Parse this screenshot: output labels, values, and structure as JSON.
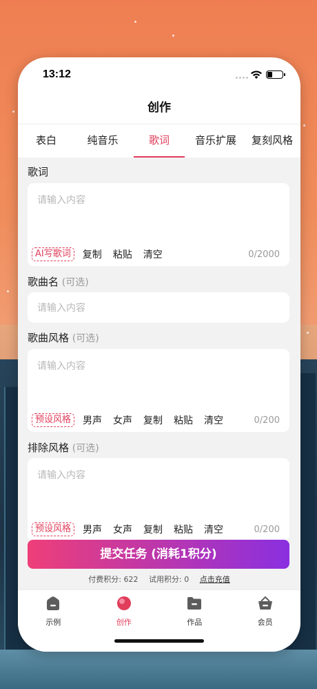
{
  "status_bar": {
    "time": "13:12"
  },
  "header": {
    "title": "创作"
  },
  "tabs": [
    {
      "label": "表白"
    },
    {
      "label": "纯音乐"
    },
    {
      "label": "歌词"
    },
    {
      "label": "音乐扩展"
    },
    {
      "label": "复刻风格"
    }
  ],
  "form": {
    "lyrics": {
      "label": "歌词",
      "placeholder": "请输入内容",
      "ai_tag": "AI写歌词",
      "copy": "复制",
      "paste": "粘贴",
      "clear": "清空",
      "counter": "0/2000"
    },
    "song_name": {
      "label": "歌曲名",
      "optional": "(可选)",
      "placeholder": "请输入内容"
    },
    "style": {
      "label": "歌曲风格",
      "optional": "(可选)",
      "placeholder": "请输入内容",
      "preset_tag": "预设风格",
      "male": "男声",
      "female": "女声",
      "copy": "复制",
      "paste": "粘贴",
      "clear": "清空",
      "counter": "0/200"
    },
    "exclude_style": {
      "label": "排除风格",
      "optional": "(可选)",
      "placeholder": "请输入内容",
      "preset_tag": "预设风格",
      "male": "男声",
      "female": "女声",
      "copy": "复制",
      "paste": "粘贴",
      "clear": "清空",
      "counter": "0/200"
    }
  },
  "submit": {
    "label": "提交任务 (消耗1积分)"
  },
  "points": {
    "paid": "付费积分: 622",
    "trial": "试用积分: 0",
    "recharge": "点击充值"
  },
  "tabbar": [
    {
      "label": "示例",
      "icon": "home-icon"
    },
    {
      "label": "创作",
      "icon": "create-icon"
    },
    {
      "label": "作品",
      "icon": "folder-icon"
    },
    {
      "label": "会员",
      "icon": "basket-icon"
    }
  ],
  "colors": {
    "accent": "#e03d5a",
    "gradient_start": "#ee3f78",
    "gradient_end": "#8a2fe0"
  }
}
